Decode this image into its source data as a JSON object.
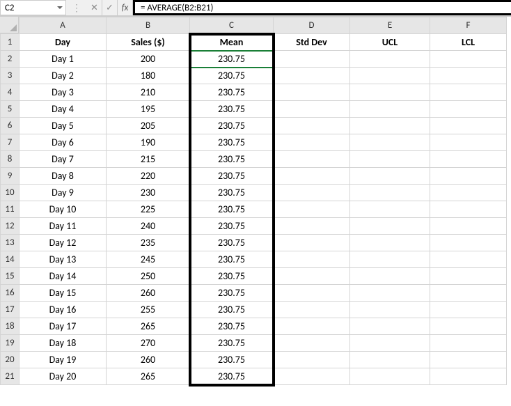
{
  "formula_bar": {
    "cell_ref": "C2",
    "fx_label": "fx",
    "formula": "= AVERAGE(B2:B21)"
  },
  "columns": [
    "A",
    "B",
    "C",
    "D",
    "E",
    "F"
  ],
  "headers": {
    "A": "Day",
    "B": "Sales ($)",
    "C": "Mean",
    "D": "Std Dev",
    "E": "UCL",
    "F": "LCL"
  },
  "rows": [
    {
      "n": 2,
      "A": "Day 1",
      "B": "200",
      "C": "230.75",
      "D": "",
      "E": "",
      "F": ""
    },
    {
      "n": 3,
      "A": "Day 2",
      "B": "180",
      "C": "230.75",
      "D": "",
      "E": "",
      "F": ""
    },
    {
      "n": 4,
      "A": "Day 3",
      "B": "210",
      "C": "230.75",
      "D": "",
      "E": "",
      "F": ""
    },
    {
      "n": 5,
      "A": "Day 4",
      "B": "195",
      "C": "230.75",
      "D": "",
      "E": "",
      "F": ""
    },
    {
      "n": 6,
      "A": "Day 5",
      "B": "205",
      "C": "230.75",
      "D": "",
      "E": "",
      "F": ""
    },
    {
      "n": 7,
      "A": "Day 6",
      "B": "190",
      "C": "230.75",
      "D": "",
      "E": "",
      "F": ""
    },
    {
      "n": 8,
      "A": "Day 7",
      "B": "215",
      "C": "230.75",
      "D": "",
      "E": "",
      "F": ""
    },
    {
      "n": 9,
      "A": "Day 8",
      "B": "220",
      "C": "230.75",
      "D": "",
      "E": "",
      "F": ""
    },
    {
      "n": 10,
      "A": "Day 9",
      "B": "230",
      "C": "230.75",
      "D": "",
      "E": "",
      "F": ""
    },
    {
      "n": 11,
      "A": "Day 10",
      "B": "225",
      "C": "230.75",
      "D": "",
      "E": "",
      "F": ""
    },
    {
      "n": 12,
      "A": "Day 11",
      "B": "240",
      "C": "230.75",
      "D": "",
      "E": "",
      "F": ""
    },
    {
      "n": 13,
      "A": "Day 12",
      "B": "235",
      "C": "230.75",
      "D": "",
      "E": "",
      "F": ""
    },
    {
      "n": 14,
      "A": "Day 13",
      "B": "245",
      "C": "230.75",
      "D": "",
      "E": "",
      "F": ""
    },
    {
      "n": 15,
      "A": "Day 14",
      "B": "250",
      "C": "230.75",
      "D": "",
      "E": "",
      "F": ""
    },
    {
      "n": 16,
      "A": "Day 15",
      "B": "260",
      "C": "230.75",
      "D": "",
      "E": "",
      "F": ""
    },
    {
      "n": 17,
      "A": "Day 16",
      "B": "255",
      "C": "230.75",
      "D": "",
      "E": "",
      "F": ""
    },
    {
      "n": 18,
      "A": "Day 17",
      "B": "265",
      "C": "230.75",
      "D": "",
      "E": "",
      "F": ""
    },
    {
      "n": 19,
      "A": "Day 18",
      "B": "270",
      "C": "230.75",
      "D": "",
      "E": "",
      "F": ""
    },
    {
      "n": 20,
      "A": "Day 19",
      "B": "260",
      "C": "230.75",
      "D": "",
      "E": "",
      "F": ""
    },
    {
      "n": 21,
      "A": "Day 20",
      "B": "265",
      "C": "230.75",
      "D": "",
      "E": "",
      "F": ""
    }
  ],
  "selected_cell": "C2"
}
